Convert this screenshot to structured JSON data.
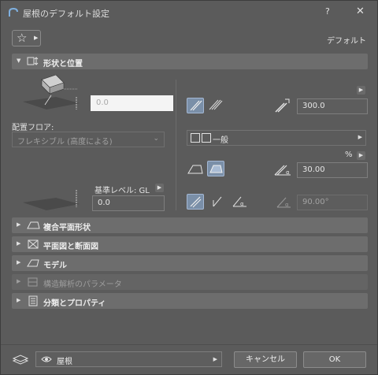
{
  "window": {
    "title": "屋根のデフォルト設定",
    "help": "?",
    "close": "✕"
  },
  "toolbar": {
    "default_label": "デフォルト"
  },
  "geometry_panel": {
    "header": "形状と位置",
    "top_offset_value": "0.0",
    "home_floor_label": "配置フロア:",
    "home_floor_value": "フレキシブル (高度による)",
    "ref_level_label": "基準レベル: GL",
    "ref_level_value": "0.0",
    "thickness_value": "300.0",
    "structure_label": "一般",
    "percent_label": "%",
    "pitch_value": "30.00",
    "angle_value": "90.00°"
  },
  "panels": [
    {
      "label": "複合平面形状",
      "disabled": false
    },
    {
      "label": "平面図と断面図",
      "disabled": false
    },
    {
      "label": "モデル",
      "disabled": false
    },
    {
      "label": "構造解析のパラメータ",
      "disabled": true
    },
    {
      "label": "分類とプロパティ",
      "disabled": false
    }
  ],
  "footer": {
    "layer_name": "屋根",
    "cancel_label": "キャンセル",
    "ok_label": "OK"
  },
  "icons": [
    "archicad-logo-icon",
    "star-icon",
    "roof-geometry-icon",
    "eye-icon",
    "layer-icon"
  ],
  "colors": {
    "background": "#5b5b5b",
    "header": "#6d6d6d",
    "selected": "#7a8fa8",
    "highlight_field": "#f4f4f4"
  }
}
